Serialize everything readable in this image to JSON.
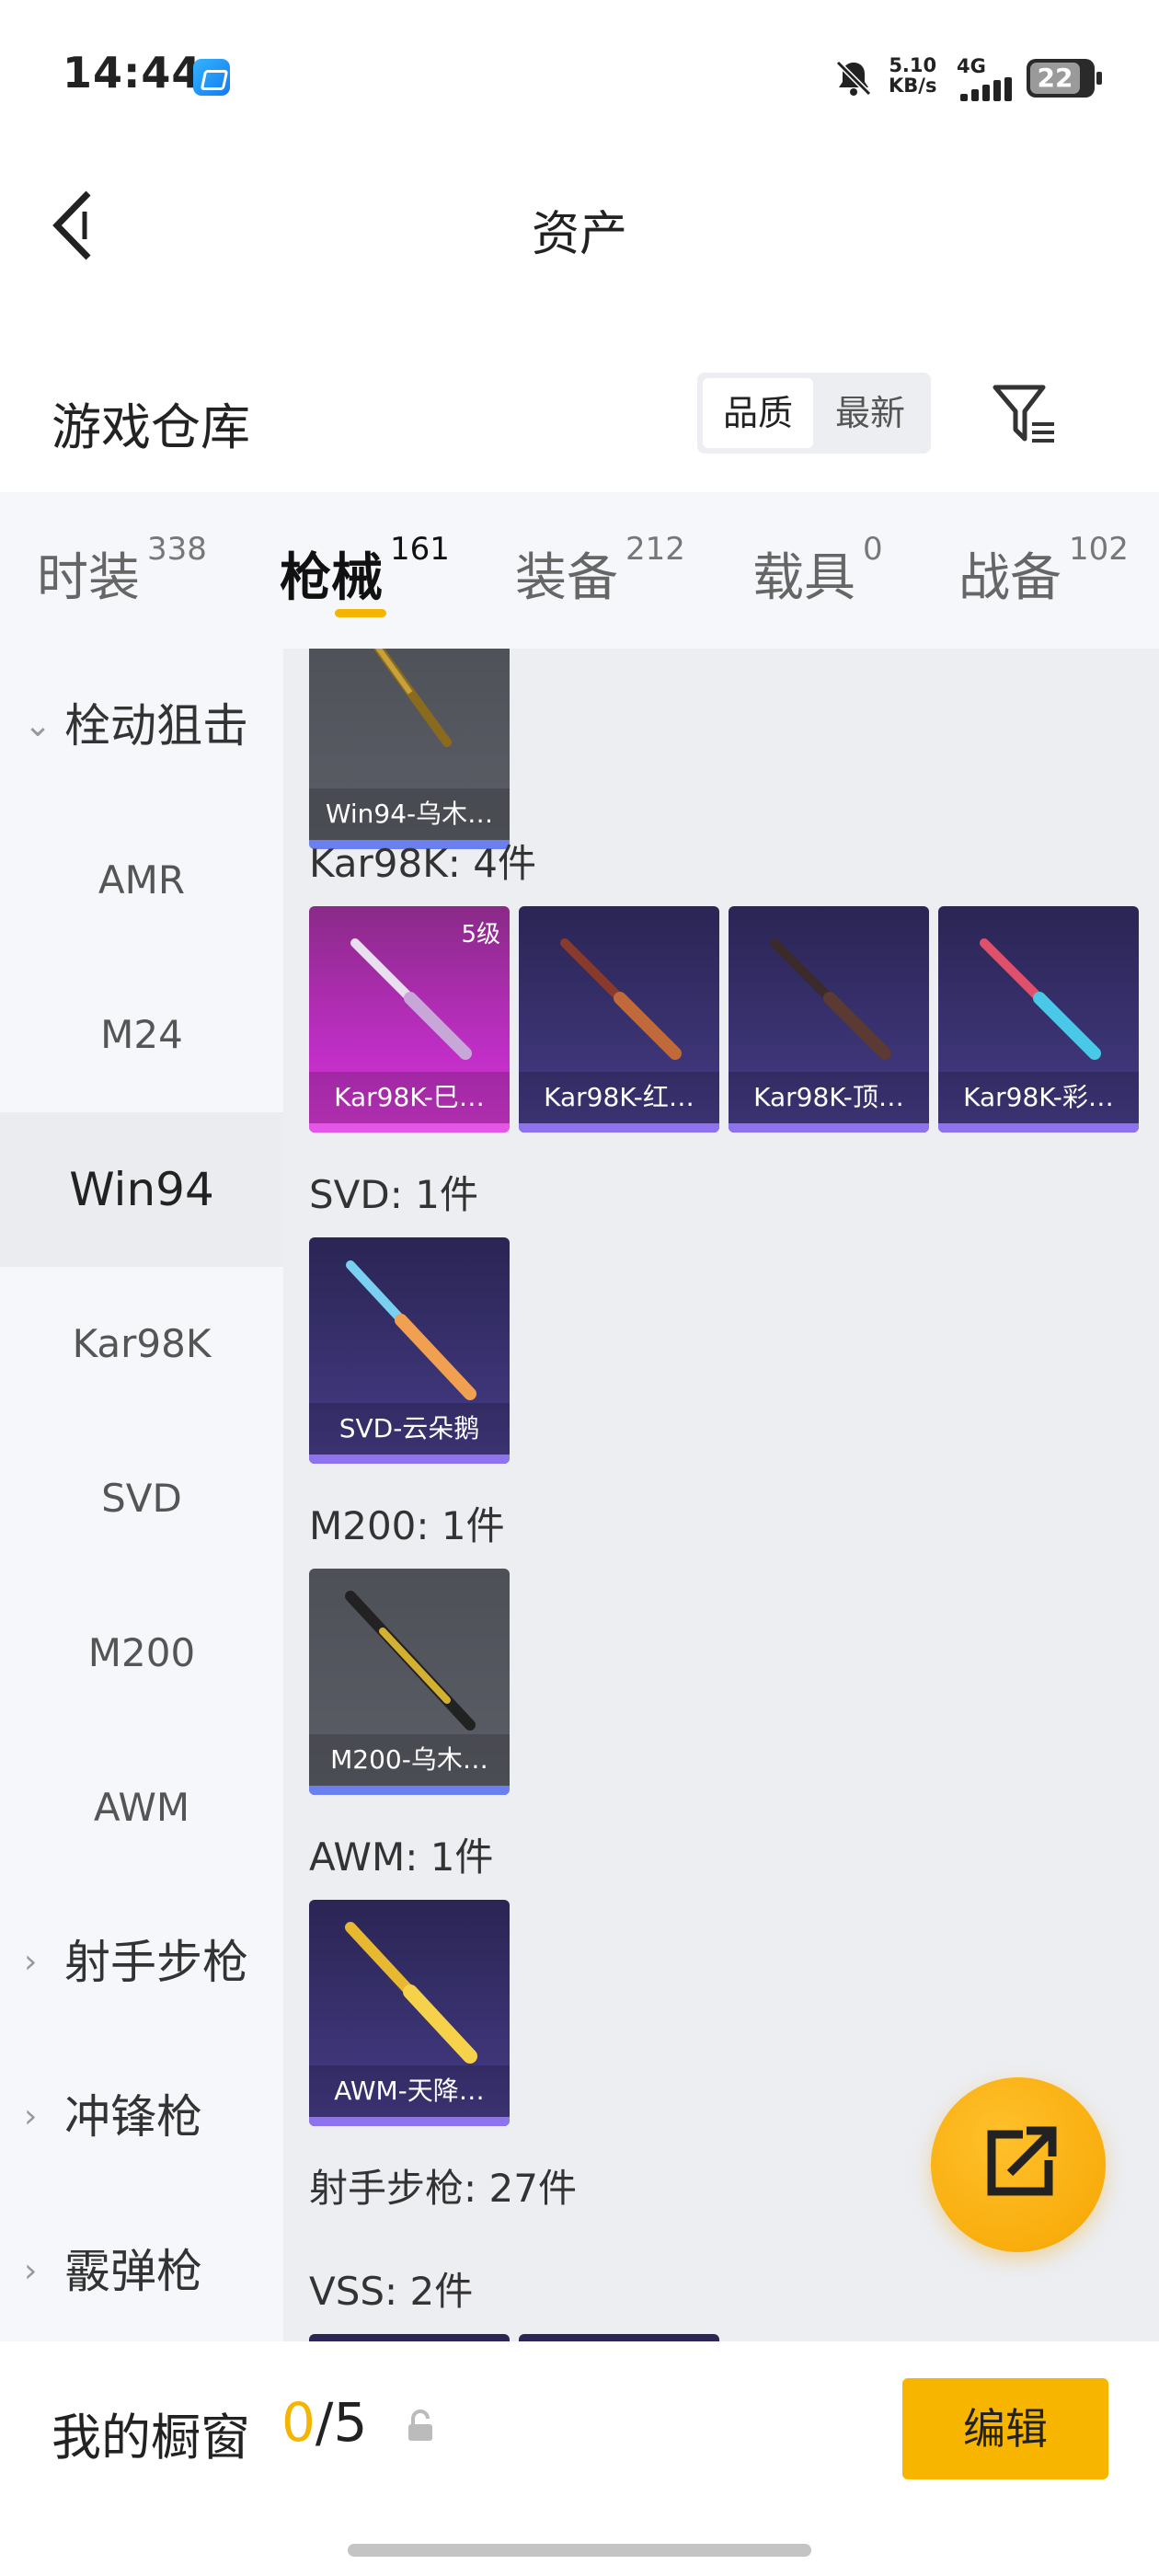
{
  "status_bar": {
    "time": "14:44",
    "net_speed_value": "5.10",
    "net_speed_unit": "KB/s",
    "network_type": "4G",
    "battery": "22"
  },
  "header": {
    "title": "资产"
  },
  "warehouse": {
    "title": "游戏仓库",
    "sort_options": [
      "品质",
      "最新"
    ],
    "active_sort": "品质"
  },
  "tabs": [
    {
      "label": "时装",
      "count": "338"
    },
    {
      "label": "枪械",
      "count": "161",
      "active": true
    },
    {
      "label": "装备",
      "count": "212"
    },
    {
      "label": "载具",
      "count": "0"
    },
    {
      "label": "战备",
      "count": "102"
    }
  ],
  "sidebar": {
    "groups": [
      {
        "label": "栓动狙击",
        "expanded": true
      },
      {
        "label": "射手步枪",
        "expanded": false
      },
      {
        "label": "冲锋枪",
        "expanded": false
      },
      {
        "label": "霰弹枪",
        "expanded": false
      }
    ],
    "items": [
      "AMR",
      "M24",
      "Win94",
      "Kar98K",
      "SVD",
      "M200",
      "AWM"
    ],
    "selected": "Win94"
  },
  "content": {
    "sections": [
      {
        "title": "",
        "cards": [
          {
            "name": "Win94-乌木…",
            "style": "gray"
          }
        ]
      },
      {
        "title": "Kar98K: 4件",
        "cards": [
          {
            "name": "Kar98K-巳…",
            "style": "pink",
            "level": "5级"
          },
          {
            "name": "Kar98K-红…",
            "style": "purple"
          },
          {
            "name": "Kar98K-顶…",
            "style": "purple"
          },
          {
            "name": "Kar98K-彩…",
            "style": "purple"
          }
        ]
      },
      {
        "title": "SVD: 1件",
        "cards": [
          {
            "name": "SVD-云朵鹅",
            "style": "purple"
          }
        ]
      },
      {
        "title": "M200: 1件",
        "cards": [
          {
            "name": "M200-乌木…",
            "style": "gray"
          }
        ]
      },
      {
        "title": "AWM: 1件",
        "cards": [
          {
            "name": "AWM-天降…",
            "style": "purple"
          }
        ]
      },
      {
        "title": "射手步枪: 27件",
        "cards": []
      },
      {
        "title": "VSS: 2件",
        "cards": []
      }
    ]
  },
  "showcase": {
    "label": "我的橱窗",
    "current": "0",
    "separator": "/",
    "max": "5",
    "edit_label": "编辑"
  },
  "colors": {
    "accent": "#f5b400",
    "card_purple": "#3d3577",
    "card_pink": "#c02ec6",
    "card_gray": "#5d5f68"
  }
}
